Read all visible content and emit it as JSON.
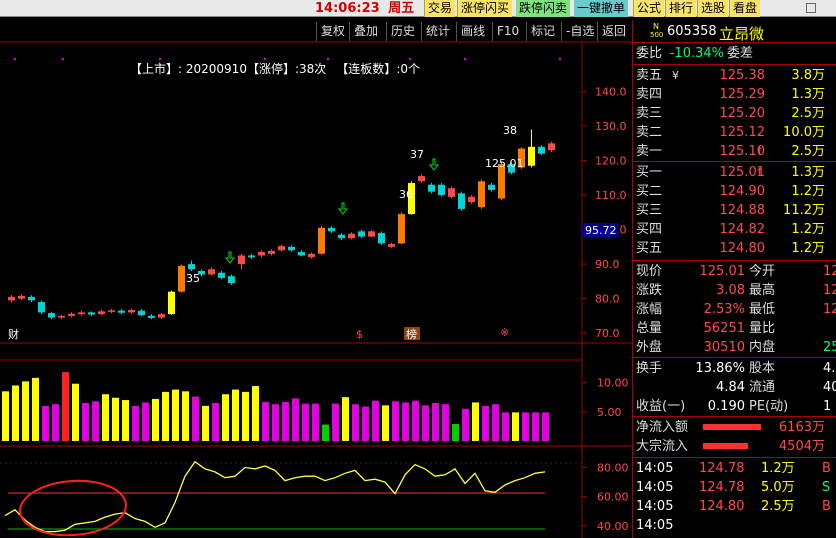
{
  "topbar": {
    "time": "14:06:23",
    "weekday": "周五",
    "buttons": [
      "交易",
      "涨停闪买",
      "跌停闪卖",
      "一键撤单",
      "公式",
      "排行",
      "选股",
      "看盘"
    ]
  },
  "chart_toolbar": {
    "buttons": [
      "复权",
      "叠加",
      "历史",
      "统计",
      "画线",
      "F10",
      "标记",
      "-自选",
      "返回"
    ]
  },
  "info_line": {
    "listing_label": "【上市】",
    "listing_date": ": 20200910",
    "limit_up_label": "【涨停】",
    "limit_up_count": ":38次",
    "streak_label": "【连板数】",
    "streak_count": ":0个"
  },
  "chart_data": [
    {
      "type": "candlestick",
      "title": "",
      "ylim": [
        68,
        148
      ],
      "y_ticks": [
        70.0,
        80.0,
        90.0,
        100.0,
        110.0,
        120.0,
        130.0,
        140.0
      ],
      "current_price_marker": "95.72",
      "annotations": [
        "35",
        "36",
        "37",
        "38",
        "125.01"
      ],
      "bottom_markers": [
        "财",
        "$",
        "榜",
        "※"
      ],
      "candles": [
        {
          "o": 79.5,
          "c": 80.5,
          "h": 81.0,
          "l": 79.0
        },
        {
          "o": 80.0,
          "c": 80.8,
          "h": 81.2,
          "l": 79.6
        },
        {
          "o": 80.5,
          "c": 79.5,
          "h": 81.0,
          "l": 79.0
        },
        {
          "o": 79.0,
          "c": 76.0,
          "h": 79.5,
          "l": 75.5
        },
        {
          "o": 75.8,
          "c": 74.5,
          "h": 76.2,
          "l": 74.0
        },
        {
          "o": 74.5,
          "c": 75.0,
          "h": 75.3,
          "l": 74.0
        },
        {
          "o": 75.0,
          "c": 75.6,
          "h": 76.0,
          "l": 74.6
        },
        {
          "o": 75.5,
          "c": 76.0,
          "h": 76.5,
          "l": 75.0
        },
        {
          "o": 76.0,
          "c": 75.4,
          "h": 76.3,
          "l": 75.0
        },
        {
          "o": 75.5,
          "c": 76.3,
          "h": 76.8,
          "l": 75.2
        },
        {
          "o": 76.2,
          "c": 76.6,
          "h": 77.0,
          "l": 75.8
        },
        {
          "o": 76.5,
          "c": 75.9,
          "h": 77.0,
          "l": 75.5
        },
        {
          "o": 76.0,
          "c": 76.7,
          "h": 77.1,
          "l": 75.6
        },
        {
          "o": 76.5,
          "c": 75.2,
          "h": 77.0,
          "l": 74.9
        },
        {
          "o": 75.0,
          "c": 74.4,
          "h": 75.5,
          "l": 74.0
        },
        {
          "o": 74.5,
          "c": 75.5,
          "h": 75.8,
          "l": 74.2
        },
        {
          "o": 75.5,
          "c": 82.0,
          "h": 82.3,
          "l": 75.3
        },
        {
          "o": 82.0,
          "c": 89.5,
          "h": 89.8,
          "l": 81.8
        },
        {
          "o": 90.0,
          "c": 88.5,
          "h": 91.0,
          "l": 88.0
        },
        {
          "o": 88.0,
          "c": 87.0,
          "h": 88.5,
          "l": 86.5
        },
        {
          "o": 87.0,
          "c": 88.5,
          "h": 89.0,
          "l": 86.8
        },
        {
          "o": 87.5,
          "c": 86.0,
          "h": 88.0,
          "l": 85.6
        },
        {
          "o": 86.5,
          "c": 84.5,
          "h": 87.0,
          "l": 84.0
        },
        {
          "o": 90.0,
          "c": 92.5,
          "h": 93.0,
          "l": 88.5
        },
        {
          "o": 92.5,
          "c": 92.0,
          "h": 93.0,
          "l": 91.5
        },
        {
          "o": 92.5,
          "c": 93.5,
          "h": 94.0,
          "l": 92.0
        },
        {
          "o": 93.0,
          "c": 93.8,
          "h": 94.3,
          "l": 92.5
        },
        {
          "o": 94.0,
          "c": 95.2,
          "h": 95.6,
          "l": 93.6
        },
        {
          "o": 95.0,
          "c": 94.0,
          "h": 95.4,
          "l": 93.6
        },
        {
          "o": 93.5,
          "c": 92.5,
          "h": 94.0,
          "l": 92.2
        },
        {
          "o": 92.0,
          "c": 93.0,
          "h": 93.4,
          "l": 91.6
        },
        {
          "o": 93.0,
          "c": 100.5,
          "h": 101.0,
          "l": 92.8
        },
        {
          "o": 100.5,
          "c": 99.5,
          "h": 101.0,
          "l": 99.0
        },
        {
          "o": 98.5,
          "c": 97.5,
          "h": 99.0,
          "l": 97.0
        },
        {
          "o": 97.5,
          "c": 98.8,
          "h": 99.2,
          "l": 97.2
        },
        {
          "o": 99.5,
          "c": 98.0,
          "h": 100.0,
          "l": 97.6
        },
        {
          "o": 98.0,
          "c": 99.5,
          "h": 99.8,
          "l": 97.8
        },
        {
          "o": 99.0,
          "c": 96.0,
          "h": 99.5,
          "l": 95.6
        },
        {
          "o": 95.0,
          "c": 95.8,
          "h": 96.2,
          "l": 94.6
        },
        {
          "o": 96.0,
          "c": 104.5,
          "h": 105.0,
          "l": 95.8
        },
        {
          "o": 104.5,
          "c": 113.5,
          "h": 114.0,
          "l": 104.3
        },
        {
          "o": 114.0,
          "c": 115.5,
          "h": 116.0,
          "l": 113.6
        },
        {
          "o": 113.0,
          "c": 111.0,
          "h": 113.5,
          "l": 110.5
        },
        {
          "o": 113.0,
          "c": 110.0,
          "h": 113.5,
          "l": 109.6
        },
        {
          "o": 109.5,
          "c": 112.0,
          "h": 112.5,
          "l": 109.0
        },
        {
          "o": 110.5,
          "c": 106.0,
          "h": 111.0,
          "l": 105.5
        },
        {
          "o": 108.0,
          "c": 109.5,
          "h": 110.0,
          "l": 107.5
        },
        {
          "o": 106.5,
          "c": 114.0,
          "h": 114.5,
          "l": 106.0
        },
        {
          "o": 113.0,
          "c": 111.5,
          "h": 113.5,
          "l": 111.0
        },
        {
          "o": 109.0,
          "c": 119.0,
          "h": 119.5,
          "l": 108.5
        },
        {
          "o": 119.0,
          "c": 116.5,
          "h": 119.5,
          "l": 116.0
        },
        {
          "o": 118.0,
          "c": 123.5,
          "h": 123.8,
          "l": 117.6
        },
        {
          "o": 118.5,
          "c": 124.0,
          "h": 129.0,
          "l": 118.0
        },
        {
          "o": 124.0,
          "c": 122.0,
          "h": 124.5,
          "l": 121.6
        },
        {
          "o": 123.0,
          "c": 125.0,
          "h": 125.5,
          "l": 122.5
        }
      ]
    },
    {
      "type": "bar",
      "title": "",
      "ylim": [
        0,
        13
      ],
      "y_ticks": [
        5.0,
        10.0
      ],
      "colors": [
        "yellow",
        "yellow",
        "yellow",
        "yellow",
        "magenta",
        "magenta",
        "red",
        "yellow",
        "magenta",
        "magenta",
        "yellow",
        "yellow",
        "yellow",
        "magenta",
        "magenta",
        "yellow",
        "yellow",
        "yellow",
        "yellow",
        "magenta",
        "yellow",
        "magenta",
        "yellow",
        "yellow",
        "yellow",
        "yellow",
        "magenta",
        "magenta",
        "magenta",
        "magenta",
        "magenta",
        "magenta",
        "green",
        "magenta",
        "yellow",
        "magenta",
        "magenta",
        "magenta",
        "yellow",
        "magenta",
        "magenta",
        "magenta",
        "magenta",
        "magenta",
        "magenta",
        "green",
        "magenta",
        "yellow",
        "magenta",
        "magenta",
        "magenta",
        "yellow",
        "magenta",
        "magenta",
        "magenta"
      ],
      "values": [
        8.5,
        9.5,
        10.2,
        10.8,
        6.0,
        6.3,
        11.8,
        9.8,
        6.5,
        6.8,
        8.0,
        7.4,
        7.0,
        6.0,
        6.6,
        7.2,
        8.4,
        8.8,
        8.5,
        7.6,
        6.0,
        6.5,
        8.0,
        8.8,
        8.4,
        9.4,
        6.7,
        6.3,
        6.7,
        7.3,
        6.4,
        6.4,
        2.8,
        6.4,
        7.5,
        6.3,
        5.9,
        6.9,
        6.1,
        6.8,
        6.6,
        6.9,
        6.1,
        6.5,
        6.3,
        2.9,
        5.5,
        6.6,
        6.0,
        6.3,
        4.9,
        4.9,
        4.9,
        4.9,
        4.9
      ]
    },
    {
      "type": "line",
      "title": "",
      "ylim": [
        33,
        92
      ],
      "y_ticks": [
        40.0,
        60.0,
        80.0
      ],
      "series": [
        {
          "values": [
            47,
            51,
            44,
            39,
            36,
            36,
            37,
            41,
            42,
            43,
            46,
            48,
            49,
            45,
            43,
            39,
            42,
            56,
            74,
            84,
            79,
            77,
            73,
            74,
            80,
            79,
            81,
            78,
            71,
            73,
            74,
            74,
            71,
            73,
            76,
            78,
            71,
            72,
            70,
            62,
            75,
            82,
            79,
            74,
            75,
            79,
            69,
            76,
            64,
            63,
            68,
            71,
            73,
            76,
            77
          ]
        }
      ]
    }
  ],
  "quote": {
    "code": "605358",
    "name": "立昂微",
    "badge_top": "N",
    "badge_bottom": "500",
    "weibi_label": "委比",
    "weibi_value": "-10.34%",
    "weicha_label": "委差",
    "sell": [
      {
        "label": "卖五",
        "price": "125.38",
        "vol": "3.8万",
        "mark": "¥"
      },
      {
        "label": "卖四",
        "price": "125.29",
        "vol": "1.3万",
        "mark": ""
      },
      {
        "label": "卖三",
        "price": "125.20",
        "vol": "2.5万",
        "mark": ""
      },
      {
        "label": "卖二",
        "price": "125.12",
        "vol": "10.0万",
        "mark": ""
      },
      {
        "label": "卖一",
        "price": "125.10",
        "vol": "2.5万",
        "mark": "↑"
      }
    ],
    "buy": [
      {
        "label": "买一",
        "price": "125.01",
        "vol": "1.3万",
        "mark": "↑"
      },
      {
        "label": "买二",
        "price": "124.90",
        "vol": "1.2万",
        "mark": ""
      },
      {
        "label": "买三",
        "price": "124.88",
        "vol": "11.2万",
        "mark": ""
      },
      {
        "label": "买四",
        "price": "124.82",
        "vol": "1.2万",
        "mark": ""
      },
      {
        "label": "买五",
        "price": "124.80",
        "vol": "1.2万",
        "mark": ""
      }
    ],
    "stats": [
      {
        "l1": "现价",
        "v1": "125.01",
        "l2": "今开",
        "v2": "12"
      },
      {
        "l1": "涨跌",
        "v1": "3.08",
        "l2": "最高",
        "v2": "12"
      },
      {
        "l1": "涨幅",
        "v1": "2.53%",
        "l2": "最低",
        "v2": "12"
      },
      {
        "l1": "总量",
        "v1": "56251",
        "l2": "量比",
        "v2": ""
      },
      {
        "l1": "外盘",
        "v1": "30510",
        "l2": "内盘",
        "v2": "25"
      }
    ],
    "stats2": [
      {
        "l1": "换手",
        "v1": "13.86%",
        "l2": "股本",
        "v2": "4."
      },
      {
        "l1": "",
        "v1": "4.84",
        "l2": "流通",
        "v2": "40"
      },
      {
        "l1": "收益(一)",
        "v1": "0.190",
        "l2": "PE(动)",
        "v2": "1"
      }
    ],
    "flows": [
      {
        "label": "净流入额",
        "value": "6163万"
      },
      {
        "label": "大宗流入",
        "value": "4504万"
      }
    ],
    "trades": [
      {
        "time": "14:05",
        "price": "124.78",
        "vol": "1.2万",
        "side": "B"
      },
      {
        "time": "14:05",
        "price": "124.78",
        "vol": "5.0万",
        "side": "S"
      },
      {
        "time": "14:05",
        "price": "124.80",
        "vol": "2.5万",
        "side": "B"
      },
      {
        "time": "14:05",
        "price": "",
        "vol": "",
        "side": ""
      }
    ]
  },
  "colors": {
    "up": "#ff4a4a",
    "down": "#00d4d4",
    "axis": "#a00000",
    "yellow": "#ffff00",
    "magenta": "#e000e0",
    "green": "#00d000"
  }
}
